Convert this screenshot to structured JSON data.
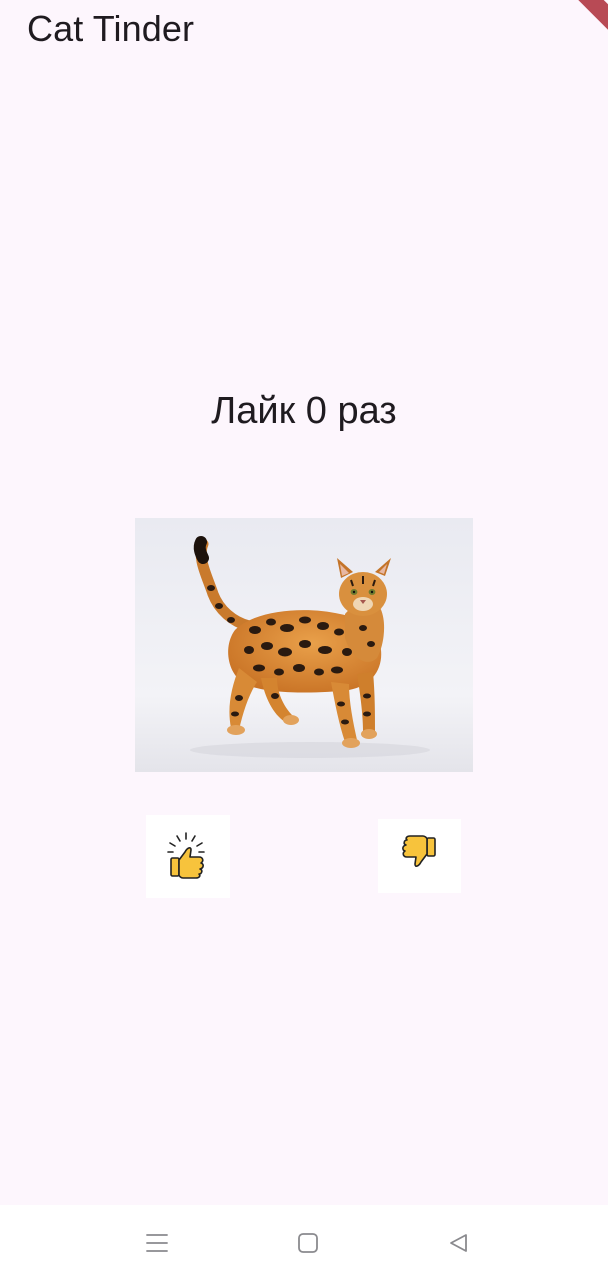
{
  "app": {
    "title": "Cat Tinder"
  },
  "main": {
    "like_counter": "Лайк 0 раз",
    "like_count": 0
  },
  "image": {
    "subject": "bengal-cat-photo"
  },
  "actions": {
    "like_icon": "thumbs-up-icon",
    "dislike_icon": "thumbs-down-icon"
  },
  "system_nav": {
    "buttons": [
      "menu-icon",
      "home-icon",
      "back-icon"
    ]
  },
  "colors": {
    "background": "#fdf6fd",
    "text": "#1f1b20",
    "button_bg": "#ffffff",
    "icon_yellow": "#f7c33c",
    "debug_banner": "#b84a55"
  }
}
